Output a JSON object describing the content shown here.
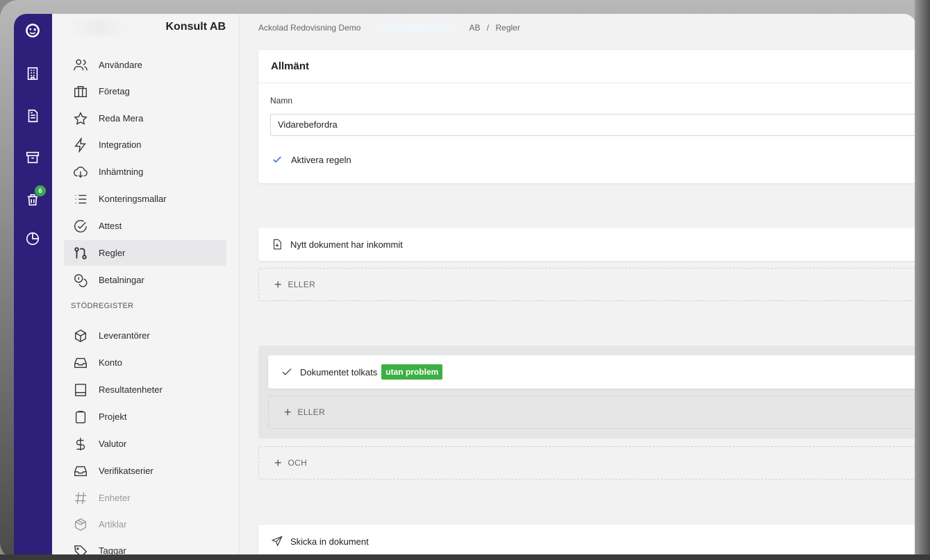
{
  "sidebar": {
    "company": "Konsult AB",
    "items": [
      {
        "label": "Användare",
        "icon": "users-icon"
      },
      {
        "label": "Företag",
        "icon": "briefcase-icon"
      },
      {
        "label": "Reda Mera",
        "icon": "star-icon"
      },
      {
        "label": "Integration",
        "icon": "lightning-icon"
      },
      {
        "label": "Inhämtning",
        "icon": "cloud-download-icon"
      },
      {
        "label": "Konteringsmallar",
        "icon": "list-icon"
      },
      {
        "label": "Attest",
        "icon": "check-circle-icon"
      },
      {
        "label": "Regler",
        "icon": "git-compare-icon"
      },
      {
        "label": "Betalningar",
        "icon": "coins-icon"
      }
    ],
    "section_label": "STÖDREGISTER",
    "register_items": [
      {
        "label": "Leverantörer",
        "icon": "box-icon"
      },
      {
        "label": "Konto",
        "icon": "inbox-icon"
      },
      {
        "label": "Resultatenheter",
        "icon": "book-icon"
      },
      {
        "label": "Projekt",
        "icon": "clipboard-icon"
      },
      {
        "label": "Valutor",
        "icon": "dollar-icon"
      },
      {
        "label": "Verifikatserier",
        "icon": "inbox-icon"
      },
      {
        "label": "Enheter",
        "icon": "hash-icon"
      },
      {
        "label": "Artiklar",
        "icon": "package-icon"
      },
      {
        "label": "Taggar",
        "icon": "tag-icon"
      }
    ]
  },
  "rail": {
    "badge_count": "6"
  },
  "breadcrumb": {
    "part1": "Ackolad Redovisning Demo",
    "part2": "AB",
    "separator": "/",
    "current": "Regler"
  },
  "general": {
    "title": "Allmänt",
    "name_label": "Namn",
    "name_value": "Vidarebefordra",
    "activate_label": "Aktivera regeln"
  },
  "trigger": {
    "label": "Nytt dokument har inkommit",
    "or_label": "ELLER"
  },
  "condition": {
    "label": "Dokumentet tolkats",
    "tag": "utan problem",
    "or_label": "ELLER",
    "and_label": "OCH"
  },
  "action": {
    "label": "Skicka in dokument"
  },
  "colors": {
    "rail": "#2d1f7a",
    "tag_green": "#3cb043",
    "checkbox_blue": "#2b64d4"
  }
}
